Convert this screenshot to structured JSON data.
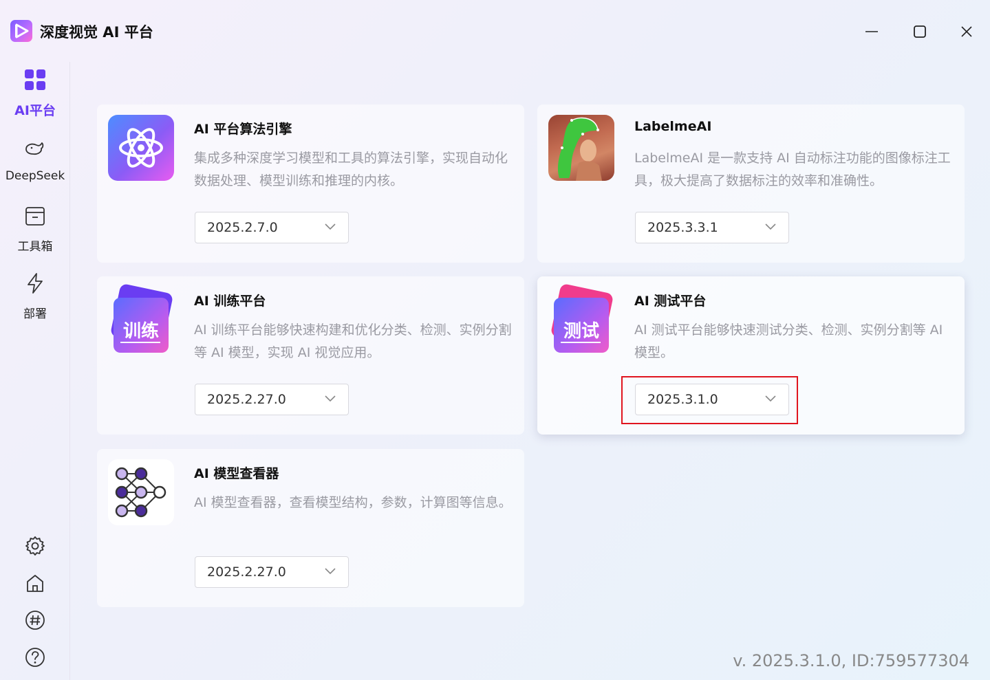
{
  "app": {
    "title": "深度视觉 AI 平台"
  },
  "window_controls": {
    "minimize": "minimize-icon",
    "maximize": "maximize-icon",
    "close": "close-icon"
  },
  "sidebar": {
    "items": [
      {
        "label": "AI平台",
        "icon": "grid-icon",
        "active": true
      },
      {
        "label": "DeepSeek",
        "icon": "whale-icon",
        "active": false
      },
      {
        "label": "工具箱",
        "icon": "toolbox-icon",
        "active": false
      },
      {
        "label": "部署",
        "icon": "lightning-icon",
        "active": false
      }
    ],
    "bottom_icons": [
      "gear-icon",
      "home-icon",
      "hash-icon",
      "help-icon"
    ]
  },
  "cards": [
    {
      "title": "AI 平台算法引擎",
      "description": "集成多种深度学习模型和工具的算法引擎，实现自动化数据处理、模型训练和推理的内核。",
      "version": "2025.2.7.0"
    },
    {
      "title": "LabelmeAI",
      "description": "LabelmeAI 是一款支持 AI 自动标注功能的图像标注工具，极大提高了数据标注的效率和准确性。",
      "version": "2025.3.3.1"
    },
    {
      "title": "AI 训练平台",
      "description": "AI 训练平台能够快速构建和优化分类、检测、实例分割等 AI 模型，实现 AI 视觉应用。",
      "version": "2025.2.27.0",
      "thumb_text": "训练"
    },
    {
      "title": "AI 测试平台",
      "description": "AI 测试平台能够快速测试分类、检测、实例分割等 AI 模型。",
      "version": "2025.3.1.0",
      "thumb_text": "测试"
    },
    {
      "title": "AI 模型查看器",
      "description": "AI 模型查看器，查看模型结构，参数，计算图等信息。",
      "version": "2025.2.27.0"
    }
  ],
  "footer": {
    "version_text": "v. 2025.3.1.0, ID:759577304"
  }
}
